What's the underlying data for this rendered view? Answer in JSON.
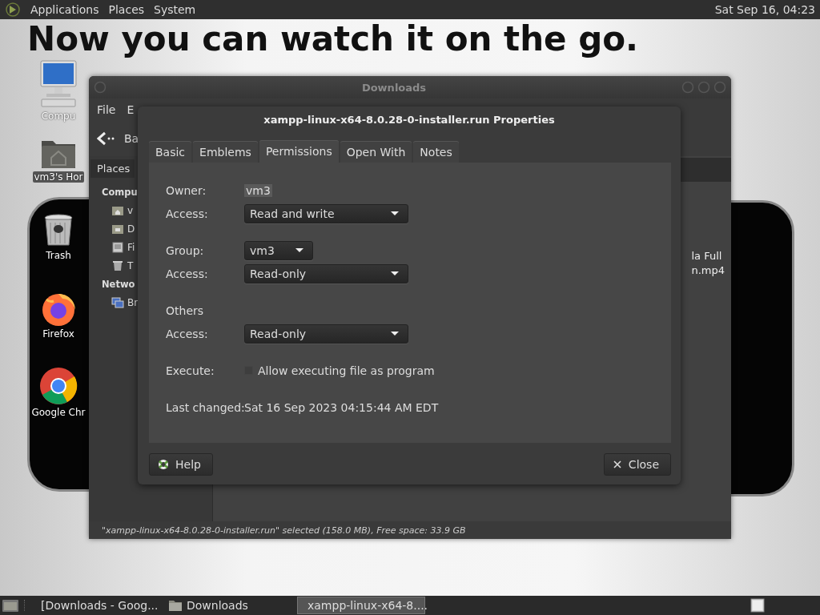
{
  "top_panel": {
    "menus": [
      "Applications",
      "Places",
      "System"
    ],
    "clock": "Sat Sep 16, 04:23"
  },
  "wallpaper": {
    "headline": "Now you can watch it on the go."
  },
  "desktop_icons": [
    {
      "label": "Compu",
      "kind": "computer",
      "selected": false
    },
    {
      "label": "vm3's Hor",
      "kind": "home",
      "selected": true
    },
    {
      "label": "Trash",
      "kind": "trash",
      "selected": false
    },
    {
      "label": "Firefox",
      "kind": "firefox",
      "selected": false
    },
    {
      "label": "Google Chr",
      "kind": "chrome",
      "selected": false
    }
  ],
  "file_manager": {
    "title": "Downloads",
    "menus": [
      "File",
      "E"
    ],
    "back_button": "Ba",
    "sidebar_tab": "Places",
    "sidebar": [
      {
        "label": "Compu",
        "kind": "heading"
      },
      {
        "label": "v",
        "kind": "home"
      },
      {
        "label": "D",
        "kind": "desktop"
      },
      {
        "label": "Fi",
        "kind": "drive"
      },
      {
        "label": "T",
        "kind": "trash"
      },
      {
        "label": "Netwo",
        "kind": "heading"
      },
      {
        "label": "Br",
        "kind": "network"
      }
    ],
    "file_name_lines": [
      "la Full",
      "n.mp4"
    ],
    "status_bar": "\"xampp-linux-x64-8.0.28-0-installer.run\" selected (158.0 MB), Free space: 33.9 GB"
  },
  "dialog": {
    "title": "xampp-linux-x64-8.0.28-0-installer.run Properties",
    "tabs": [
      {
        "label": "Basic",
        "selected": false
      },
      {
        "label": "Emblems",
        "selected": false
      },
      {
        "label": "Permissions",
        "selected": true
      },
      {
        "label": "Open With",
        "selected": false
      },
      {
        "label": "Notes",
        "selected": false
      }
    ],
    "rows": [
      {
        "kind": "text",
        "label": "Owner:",
        "value": "vm3"
      },
      {
        "kind": "combo",
        "label": "Access:",
        "value": "Read and write"
      },
      {
        "kind": "short_combo",
        "label": "Group:",
        "value": "vm3"
      },
      {
        "kind": "combo",
        "label": "Access:",
        "value": "Read-only"
      },
      {
        "kind": "heading",
        "label": "Others"
      },
      {
        "kind": "combo",
        "label": "Access:",
        "value": "Read-only"
      },
      {
        "kind": "check",
        "label": "Execute:",
        "option": "Allow executing file as program",
        "checked": false
      },
      {
        "kind": "text",
        "label": "Last changed:",
        "value": "Sat 16 Sep 2023 04:15:44 AM EDT"
      }
    ],
    "buttons": [
      {
        "label": "Help",
        "kind": "help"
      },
      {
        "label": "Close",
        "kind": "close"
      }
    ]
  },
  "taskbar": {
    "items": [
      {
        "label": "[Downloads - Goog...",
        "kind": "chrome",
        "selected": false
      },
      {
        "label": "Downloads",
        "kind": "folder",
        "selected": false
      },
      {
        "label": "xampp-linux-x64-8....",
        "kind": "properties",
        "selected": true
      }
    ]
  }
}
